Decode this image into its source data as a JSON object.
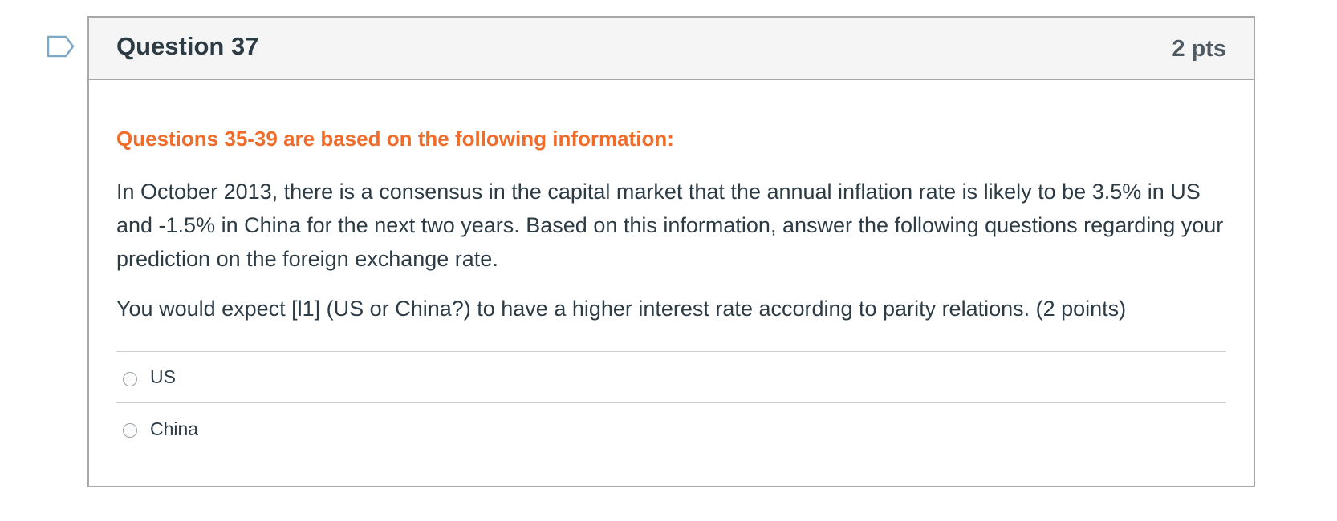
{
  "question": {
    "title": "Question 37",
    "points": "2 pts",
    "info_heading": "Questions 35-39 are based on the following information:",
    "paragraph_1": "In October 2013, there is a consensus in the capital market that the annual inflation rate is likely to be 3.5% in US and -1.5% in China for the next two years. Based on this information, answer the following questions regarding your prediction on the foreign exchange rate.",
    "paragraph_2": "You would expect [l1] (US or China?) to have a higher interest rate according to parity relations. (2 points)",
    "answers": [
      {
        "label": "US",
        "selected": false
      },
      {
        "label": "China",
        "selected": false
      }
    ]
  },
  "colors": {
    "accent_orange": "#ef6c2a",
    "text": "#2d3b45",
    "border": "#a6a8aa",
    "header_bg": "#f5f5f5"
  },
  "icons": {
    "flag": "flag-question-icon",
    "radio": "radio-unchecked-icon"
  }
}
